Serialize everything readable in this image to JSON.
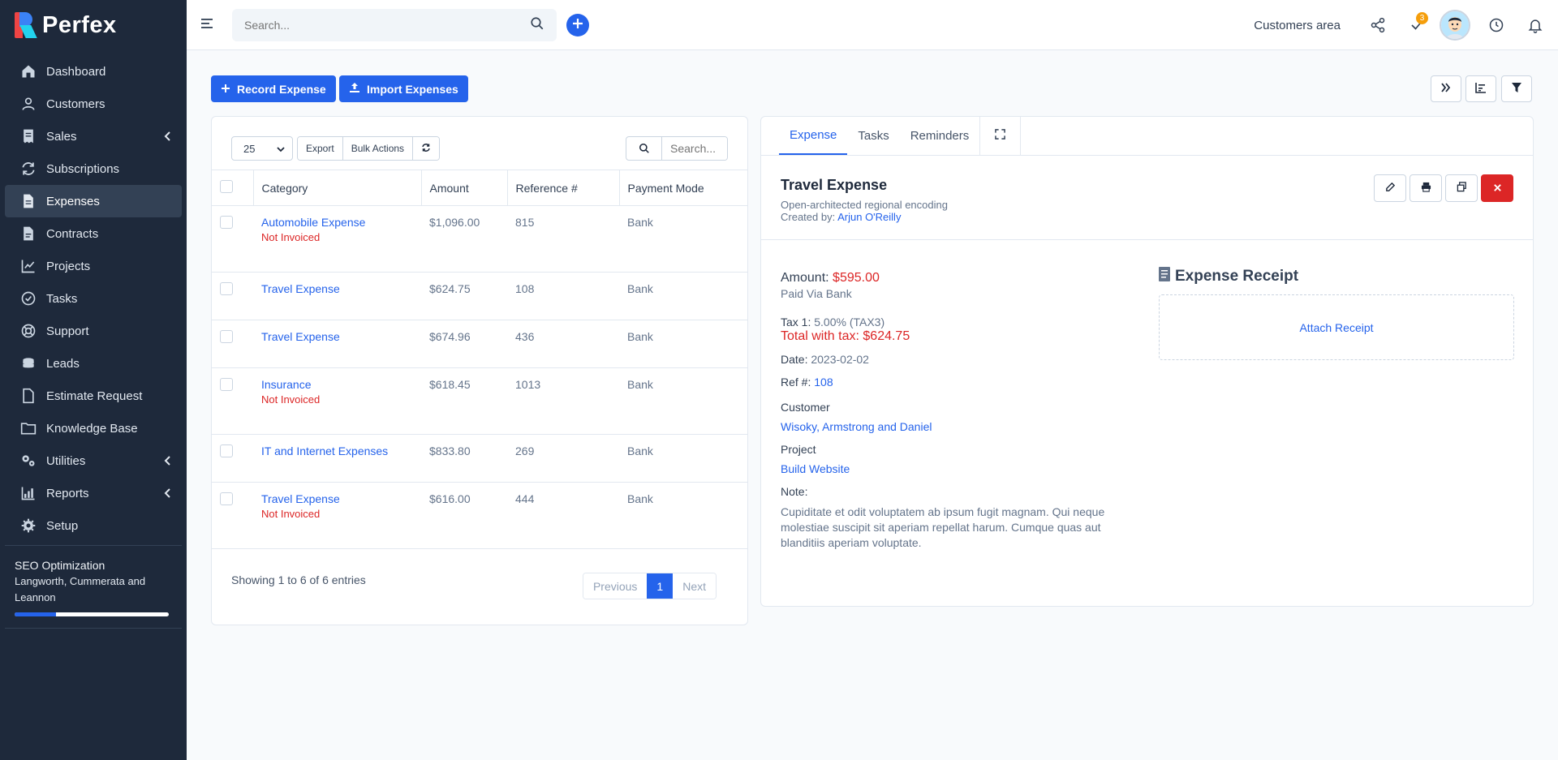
{
  "app": {
    "name": "Perfex"
  },
  "sidebar": {
    "items": [
      {
        "label": "Dashboard",
        "icon": "home-icon"
      },
      {
        "label": "Customers",
        "icon": "user-icon"
      },
      {
        "label": "Sales",
        "icon": "receipt-icon"
      },
      {
        "label": "Subscriptions",
        "icon": "refresh-icon"
      },
      {
        "label": "Expenses",
        "icon": "file-text-icon"
      },
      {
        "label": "Contracts",
        "icon": "file-icon"
      },
      {
        "label": "Projects",
        "icon": "chart-icon"
      },
      {
        "label": "Tasks",
        "icon": "check-circle-icon"
      },
      {
        "label": "Support",
        "icon": "lifebuoy-icon"
      },
      {
        "label": "Leads",
        "icon": "funnel-icon"
      },
      {
        "label": "Estimate Request",
        "icon": "document-icon"
      },
      {
        "label": "Knowledge Base",
        "icon": "folder-icon"
      },
      {
        "label": "Utilities",
        "icon": "cogs-icon"
      },
      {
        "label": "Reports",
        "icon": "bar-chart-icon"
      },
      {
        "label": "Setup",
        "icon": "gear-icon"
      }
    ],
    "project": {
      "name": "SEO Optimization",
      "client": "Langworth, Cummerata and Leannon",
      "progress": 0.27
    }
  },
  "header": {
    "search_placeholder": "Search...",
    "customers_area": "Customers area",
    "tasks_badge": "3"
  },
  "toolbar": {
    "record_expense": "Record Expense",
    "import_expenses": "Import Expenses"
  },
  "table": {
    "page_size": "25",
    "export_label": "Export",
    "bulk_actions_label": "Bulk Actions",
    "search_placeholder": "Search...",
    "columns": [
      "Category",
      "Amount",
      "Reference #",
      "Payment Mode"
    ],
    "rows": [
      {
        "category": "Automobile Expense",
        "status": "Not Invoiced",
        "amount": "$1,096.00",
        "ref": "815",
        "mode": "Bank"
      },
      {
        "category": "Travel Expense",
        "status": "",
        "amount": "$624.75",
        "ref": "108",
        "mode": "Bank"
      },
      {
        "category": "Travel Expense",
        "status": "",
        "amount": "$674.96",
        "ref": "436",
        "mode": "Bank"
      },
      {
        "category": "Insurance",
        "status": "Not Invoiced",
        "amount": "$618.45",
        "ref": "1013",
        "mode": "Bank"
      },
      {
        "category": "IT and Internet Expenses",
        "status": "",
        "amount": "$833.80",
        "ref": "269",
        "mode": "Bank"
      },
      {
        "category": "Travel Expense",
        "status": "Not Invoiced",
        "amount": "$616.00",
        "ref": "444",
        "mode": "Bank"
      }
    ],
    "footer": "Showing 1 to 6 of 6 entries",
    "pager": {
      "previous": "Previous",
      "current": "1",
      "next": "Next"
    }
  },
  "detail": {
    "tabs": [
      "Expense",
      "Tasks",
      "Reminders"
    ],
    "title": "Travel Expense",
    "subtitle": "Open-architected regional encoding",
    "created_by_label": "Created by:",
    "created_by": "Arjun O'Reilly",
    "amount_label": "Amount:",
    "amount": "$595.00",
    "paid_via": "Paid Via Bank",
    "tax_label": "Tax 1:",
    "tax": "5.00% (TAX3)",
    "total_label": "Total with tax:",
    "total": "$624.75",
    "date_label": "Date:",
    "date": "2023-02-02",
    "ref_label": "Ref #:",
    "ref": "108",
    "customer_label": "Customer",
    "customer": "Wisoky, Armstrong and Daniel",
    "project_label": "Project",
    "project": "Build Website",
    "note_label": "Note:",
    "note": "Cupiditate et odit voluptatem ab ipsum fugit magnam. Qui neque molestiae suscipit sit aperiam repellat harum. Cumque quas aut blanditiis aperiam voluptate.",
    "receipt_title": "Expense Receipt",
    "attach_receipt": "Attach Receipt"
  },
  "colors": {
    "primary": "#2563eb",
    "danger": "#dc2626",
    "sidebar": "#1e293b",
    "badge": "#f59e0b"
  }
}
